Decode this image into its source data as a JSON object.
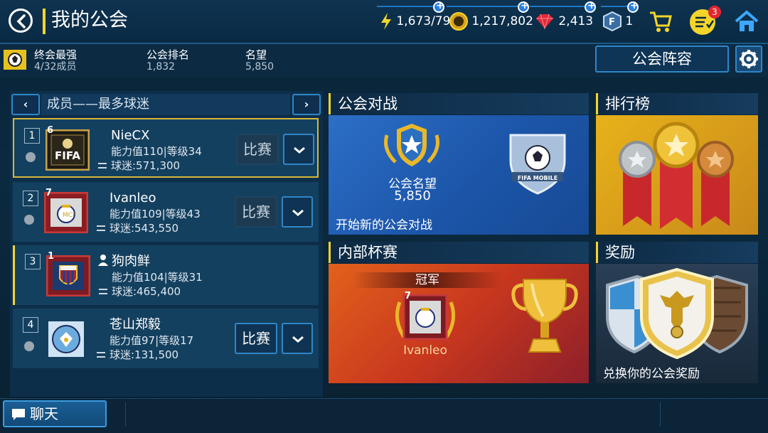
{
  "header": {
    "title": "我的公会",
    "energy": "1,673/79",
    "coins": "1,217,802",
    "gems": "2,413",
    "fifa_points": "1",
    "notification_count": "3"
  },
  "guild": {
    "name": "终会最强",
    "members": "4/32成员",
    "rank_label": "公会排名",
    "rank_value": "1,832",
    "prestige_label": "名望",
    "prestige_value": "5,850",
    "lineup_label": "公会阵容"
  },
  "members_panel": {
    "title": "成员——最多球迷",
    "rows": [
      {
        "rank": "1",
        "card_num": "6",
        "name": "NieCX",
        "stat": "能力值110|等级34",
        "fans": "球迷:571,300",
        "match": "比赛",
        "badge": "FIFA"
      },
      {
        "rank": "2",
        "card_num": "7",
        "name": "Ivanleo",
        "stat": "能力值109|等级43",
        "fans": "球迷:543,550",
        "match": "比赛",
        "badge": "Real Madrid"
      },
      {
        "rank": "3",
        "card_num": "1",
        "name": "狗肉鲜",
        "stat": "能力值104|等级31",
        "fans": "球迷:465,400",
        "match": "",
        "badge": "FCB"
      },
      {
        "rank": "4",
        "card_num": "",
        "name": "苍山郑毅",
        "stat": "能力值97|等级17",
        "fans": "球迷:131,500",
        "match": "比赛",
        "badge": "Manchester City"
      }
    ]
  },
  "tiles": {
    "war": {
      "title": "公会对战",
      "prestige_label": "公会名望",
      "prestige_value": "5,850",
      "action": "开始新的公会对战",
      "badge_text": "FIFA MOBILE"
    },
    "leaderboard": {
      "title": "排行榜"
    },
    "cup": {
      "title": "内部杯赛",
      "champion_label": "冠军",
      "champion_name": "Ivanleo",
      "card_num": "7"
    },
    "rewards": {
      "title": "奖励",
      "action": "兑换你的公会奖励"
    }
  },
  "chat": {
    "label": "聊天"
  },
  "colors": {
    "accent": "#f5d52a",
    "button_border": "#2f86c8",
    "panel": "#0d2e49"
  }
}
